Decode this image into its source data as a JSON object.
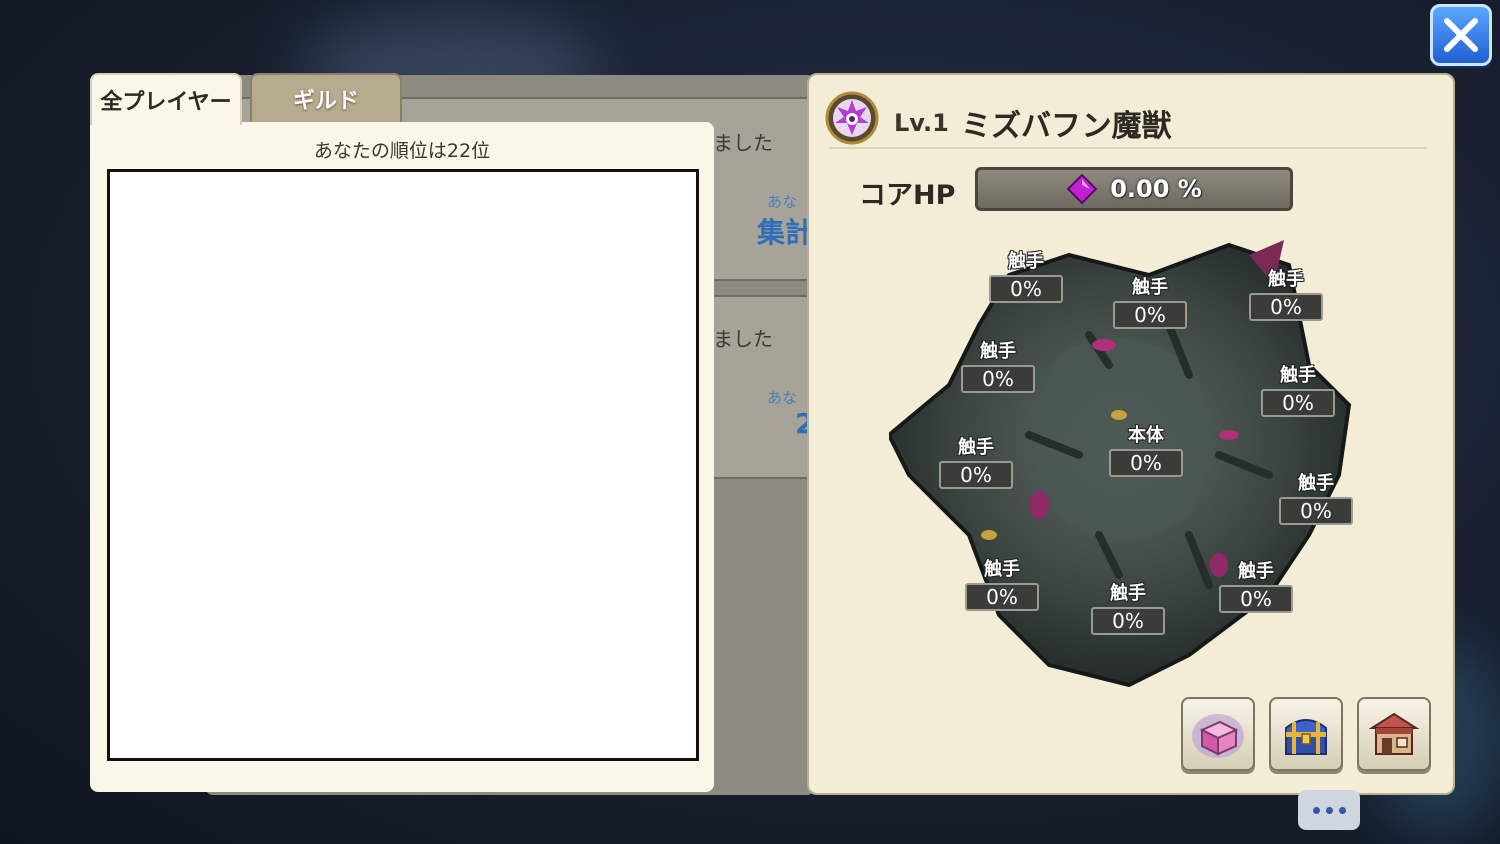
{
  "close_button": {
    "icon": "close-icon"
  },
  "tabs": [
    {
      "label": "全プレイヤー",
      "active": true
    },
    {
      "label": "ギルド",
      "active": false
    }
  ],
  "background_panel": {
    "rows": [
      {
        "status": "ました",
        "small": "あな",
        "blue": "集計"
      },
      {
        "status": "ました",
        "small": "あな",
        "blue": "2"
      }
    ]
  },
  "ranking": {
    "rank_text": "あなたの順位は22位"
  },
  "boss": {
    "level": "Lv.1",
    "name": "ミズバフン魔獣",
    "core_hp_label": "コアHP",
    "core_hp_value": "0.00 %",
    "parts": [
      {
        "name": "触手",
        "value": "0%"
      },
      {
        "name": "触手",
        "value": "0%"
      },
      {
        "name": "触手",
        "value": "0%"
      },
      {
        "name": "触手",
        "value": "0%"
      },
      {
        "name": "触手",
        "value": "0%"
      },
      {
        "name": "本体",
        "value": "0%"
      },
      {
        "name": "触手",
        "value": "0%"
      },
      {
        "name": "触手",
        "value": "0%"
      },
      {
        "name": "触手",
        "value": "0%"
      },
      {
        "name": "触手",
        "value": "0%"
      },
      {
        "name": "触手",
        "value": "0%"
      }
    ]
  },
  "action_buttons": [
    {
      "icon": "gift-box-icon"
    },
    {
      "icon": "treasure-chest-icon"
    },
    {
      "icon": "shop-icon"
    }
  ],
  "colors": {
    "accent_blue": "#1f5fd0",
    "panel_cream": "#fbf7e8",
    "gem_purple": "#c21fd1"
  }
}
